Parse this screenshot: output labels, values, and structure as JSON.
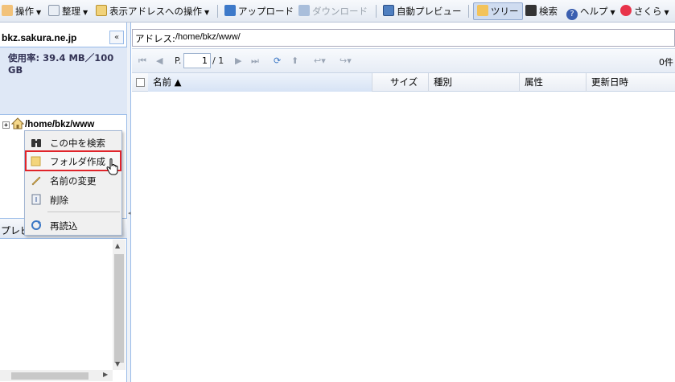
{
  "toolbar": {
    "items": [
      {
        "label": "操作",
        "icon": "hand-icon"
      },
      {
        "label": "整理",
        "icon": "clipboard-icon"
      },
      {
        "label": "表示アドレスへの操作",
        "icon": "address-icon"
      },
      {
        "label": "アップロード",
        "icon": "upload-icon"
      },
      {
        "label": "ダウンロード",
        "icon": "download-icon"
      },
      {
        "label": "自動プレビュー",
        "icon": "monitor-icon"
      },
      {
        "label": "ツリー",
        "icon": "tree-icon"
      },
      {
        "label": "検索",
        "icon": "binoculars-icon"
      },
      {
        "label": "ヘルプ",
        "icon": "help-icon"
      },
      {
        "label": "さくら",
        "icon": "sakura-icon"
      }
    ]
  },
  "left": {
    "server": "bkz.sakura.ne.jp",
    "collapse_glyph": "«",
    "usage": "使用率: 39.4 MB／100 GB",
    "tree_root": "/home/bkz/www",
    "preview_label": "プレビ"
  },
  "context_menu": {
    "items": [
      {
        "label": "この中を検索",
        "icon": "binoculars-icon"
      },
      {
        "label": "フォルダ作成",
        "icon": "folder-icon"
      },
      {
        "label": "名前の変更",
        "icon": "pencil-icon"
      },
      {
        "label": "削除",
        "icon": "delete-icon"
      },
      {
        "label": "再読込",
        "icon": "refresh-icon"
      }
    ]
  },
  "address": {
    "label": "アドレス:",
    "value": "/home/bkz/www/"
  },
  "pager": {
    "page_prefix": "P.",
    "page_value": "1",
    "page_of": "/ 1",
    "count": "0件"
  },
  "grid": {
    "columns": [
      "名前 ▲",
      "サイズ",
      "種別",
      "属性",
      "更新日時"
    ]
  },
  "colors": {
    "accent_blue": "#99bbe8",
    "highlight_red": "#e0242a"
  }
}
